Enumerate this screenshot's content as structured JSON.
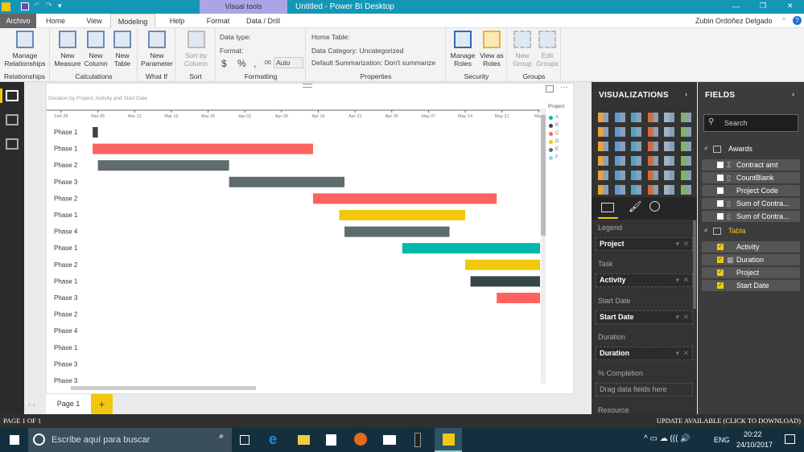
{
  "titlebar": {
    "title": "Untitled - Power BI Desktop",
    "visual_tools": "Visual tools",
    "minimize": "—",
    "restore": "❐",
    "close": "✕"
  },
  "tabs": [
    {
      "label": "Archivo"
    },
    {
      "label": "Home"
    },
    {
      "label": "View"
    },
    {
      "label": "Modeling",
      "active": true
    },
    {
      "label": "Help"
    },
    {
      "label": "Format"
    },
    {
      "label": "Data / Drill"
    }
  ],
  "user": "Zubin Ordóñez Delgado",
  "ribbon": {
    "relationships": {
      "group": "Relationships",
      "btn": "Manage Relationships"
    },
    "calculations": {
      "group": "Calculations",
      "measure": "New Measure",
      "column": "New Column",
      "table": "New Table"
    },
    "whatif": {
      "group": "What If",
      "btn": "New Parameter"
    },
    "sort": {
      "group": "Sort",
      "btn": "Sort by Column"
    },
    "formatting": {
      "group": "Formatting",
      "data_type": "Data type:",
      "format": "Format:",
      "currency": "$",
      "percent": "%",
      "comma": ",",
      "decimals": ".00",
      "auto": "Auto"
    },
    "properties": {
      "group": "Properties",
      "home_table": "Home Table:",
      "data_category": "Data Category: Uncategorized",
      "summarization": "Default Summarization: Don't summarize"
    },
    "security": {
      "group": "Security",
      "manage": "Manage Roles",
      "view": "View as Roles"
    },
    "groups": {
      "group": "Groups",
      "new": "New Group",
      "edit": "Edit Groups"
    }
  },
  "visual": {
    "title": "Duration by Project, Activity and Start Date",
    "legend_title": "Project"
  },
  "chart_data": {
    "type": "gantt",
    "title": "Duration by Project, Activity and Start Date",
    "x_ticks": [
      "Feb 26",
      "Mar 05",
      "Mar 12",
      "Mar 19",
      "Mar 26",
      "Apr 02",
      "Apr 09",
      "Apr 16",
      "Apr 23",
      "Apr 30",
      "May 07",
      "May 14",
      "May 21",
      "May"
    ],
    "x_start": "2017-02-26",
    "legend": [
      {
        "name": "A",
        "color": "#01b8aa"
      },
      {
        "name": "B",
        "color": "#374649"
      },
      {
        "name": "C",
        "color": "#fd625e"
      },
      {
        "name": "D",
        "color": "#f2c80f"
      },
      {
        "name": "E",
        "color": "#5f6b6d"
      },
      {
        "name": "F",
        "color": "#8ad4eb"
      }
    ],
    "tasks": [
      {
        "task": "Phase 1",
        "project": "B",
        "start": "2017-03-04",
        "duration": 1
      },
      {
        "task": "Phase 1",
        "project": "C",
        "start": "2017-03-04",
        "duration": 42
      },
      {
        "task": "Phase 2",
        "project": "E",
        "start": "2017-03-05",
        "duration": 25
      },
      {
        "task": "Phase 3",
        "project": "E",
        "start": "2017-03-30",
        "duration": 22
      },
      {
        "task": "Phase 2",
        "project": "C",
        "start": "2017-04-15",
        "duration": 35
      },
      {
        "task": "Phase 1",
        "project": "D",
        "start": "2017-04-20",
        "duration": 24
      },
      {
        "task": "Phase 4",
        "project": "E",
        "start": "2017-04-21",
        "duration": 20
      },
      {
        "task": "Phase 1",
        "project": "A",
        "start": "2017-05-02",
        "duration": 30
      },
      {
        "task": "Phase 2",
        "project": "D",
        "start": "2017-05-14",
        "duration": 30
      },
      {
        "task": "Phase 1",
        "project": "B",
        "start": "2017-05-15",
        "duration": 30
      },
      {
        "task": "Phase 3",
        "project": "C",
        "start": "2017-05-20",
        "duration": 30
      },
      {
        "task": "Phase 2",
        "project": "",
        "start": null,
        "duration": null
      },
      {
        "task": "Phase 4",
        "project": "",
        "start": null,
        "duration": null
      },
      {
        "task": "Phase 1",
        "project": "",
        "start": null,
        "duration": null
      },
      {
        "task": "Phase 3",
        "project": "",
        "start": null,
        "duration": null
      },
      {
        "task": "Phase 3",
        "project": "",
        "start": null,
        "duration": null
      }
    ]
  },
  "page_tabs": {
    "page": "Page 1",
    "add": "+"
  },
  "viz": {
    "title": "VISUALIZATIONS",
    "wells": [
      {
        "label": "Legend",
        "value": "Project"
      },
      {
        "label": "Task",
        "value": "Activity"
      },
      {
        "label": "Start Date",
        "value": "Start Date"
      },
      {
        "label": "Duration",
        "value": "Duration"
      },
      {
        "label": "% Completion",
        "value": "Drag data fields here"
      },
      {
        "label": "Resource"
      }
    ]
  },
  "fields": {
    "title": "FIELDS",
    "search_placeholder": "Search",
    "tables": [
      {
        "name": "Awards",
        "items": [
          {
            "label": "Contract amt",
            "checked": false,
            "icon": "Σ"
          },
          {
            "label": "CountBlank",
            "checked": false,
            "icon": "▯"
          },
          {
            "label": "Project Code",
            "checked": false,
            "icon": ""
          },
          {
            "label": "Sum of Contra...",
            "checked": false,
            "icon": "▯"
          },
          {
            "label": "Sum of Contra...",
            "checked": false,
            "icon": "▯"
          }
        ]
      },
      {
        "name": "Tabla",
        "items": [
          {
            "label": "Activity",
            "checked": true,
            "icon": ""
          },
          {
            "label": "Duration",
            "checked": true,
            "icon": "▦"
          },
          {
            "label": "Project",
            "checked": true,
            "icon": ""
          },
          {
            "label": "Start Date",
            "checked": true,
            "icon": ""
          }
        ]
      }
    ]
  },
  "status": {
    "left": "PAGE 1 OF 1",
    "right": "UPDATE AVAILABLE (CLICK TO DOWNLOAD)"
  },
  "taskbar": {
    "search": "Escribe aquí para buscar",
    "lang": "ENG",
    "time": "20:22",
    "date": "24/10/2017"
  },
  "colors": {
    "accent": "#f2c80f",
    "titlebar": "#1497b6"
  }
}
